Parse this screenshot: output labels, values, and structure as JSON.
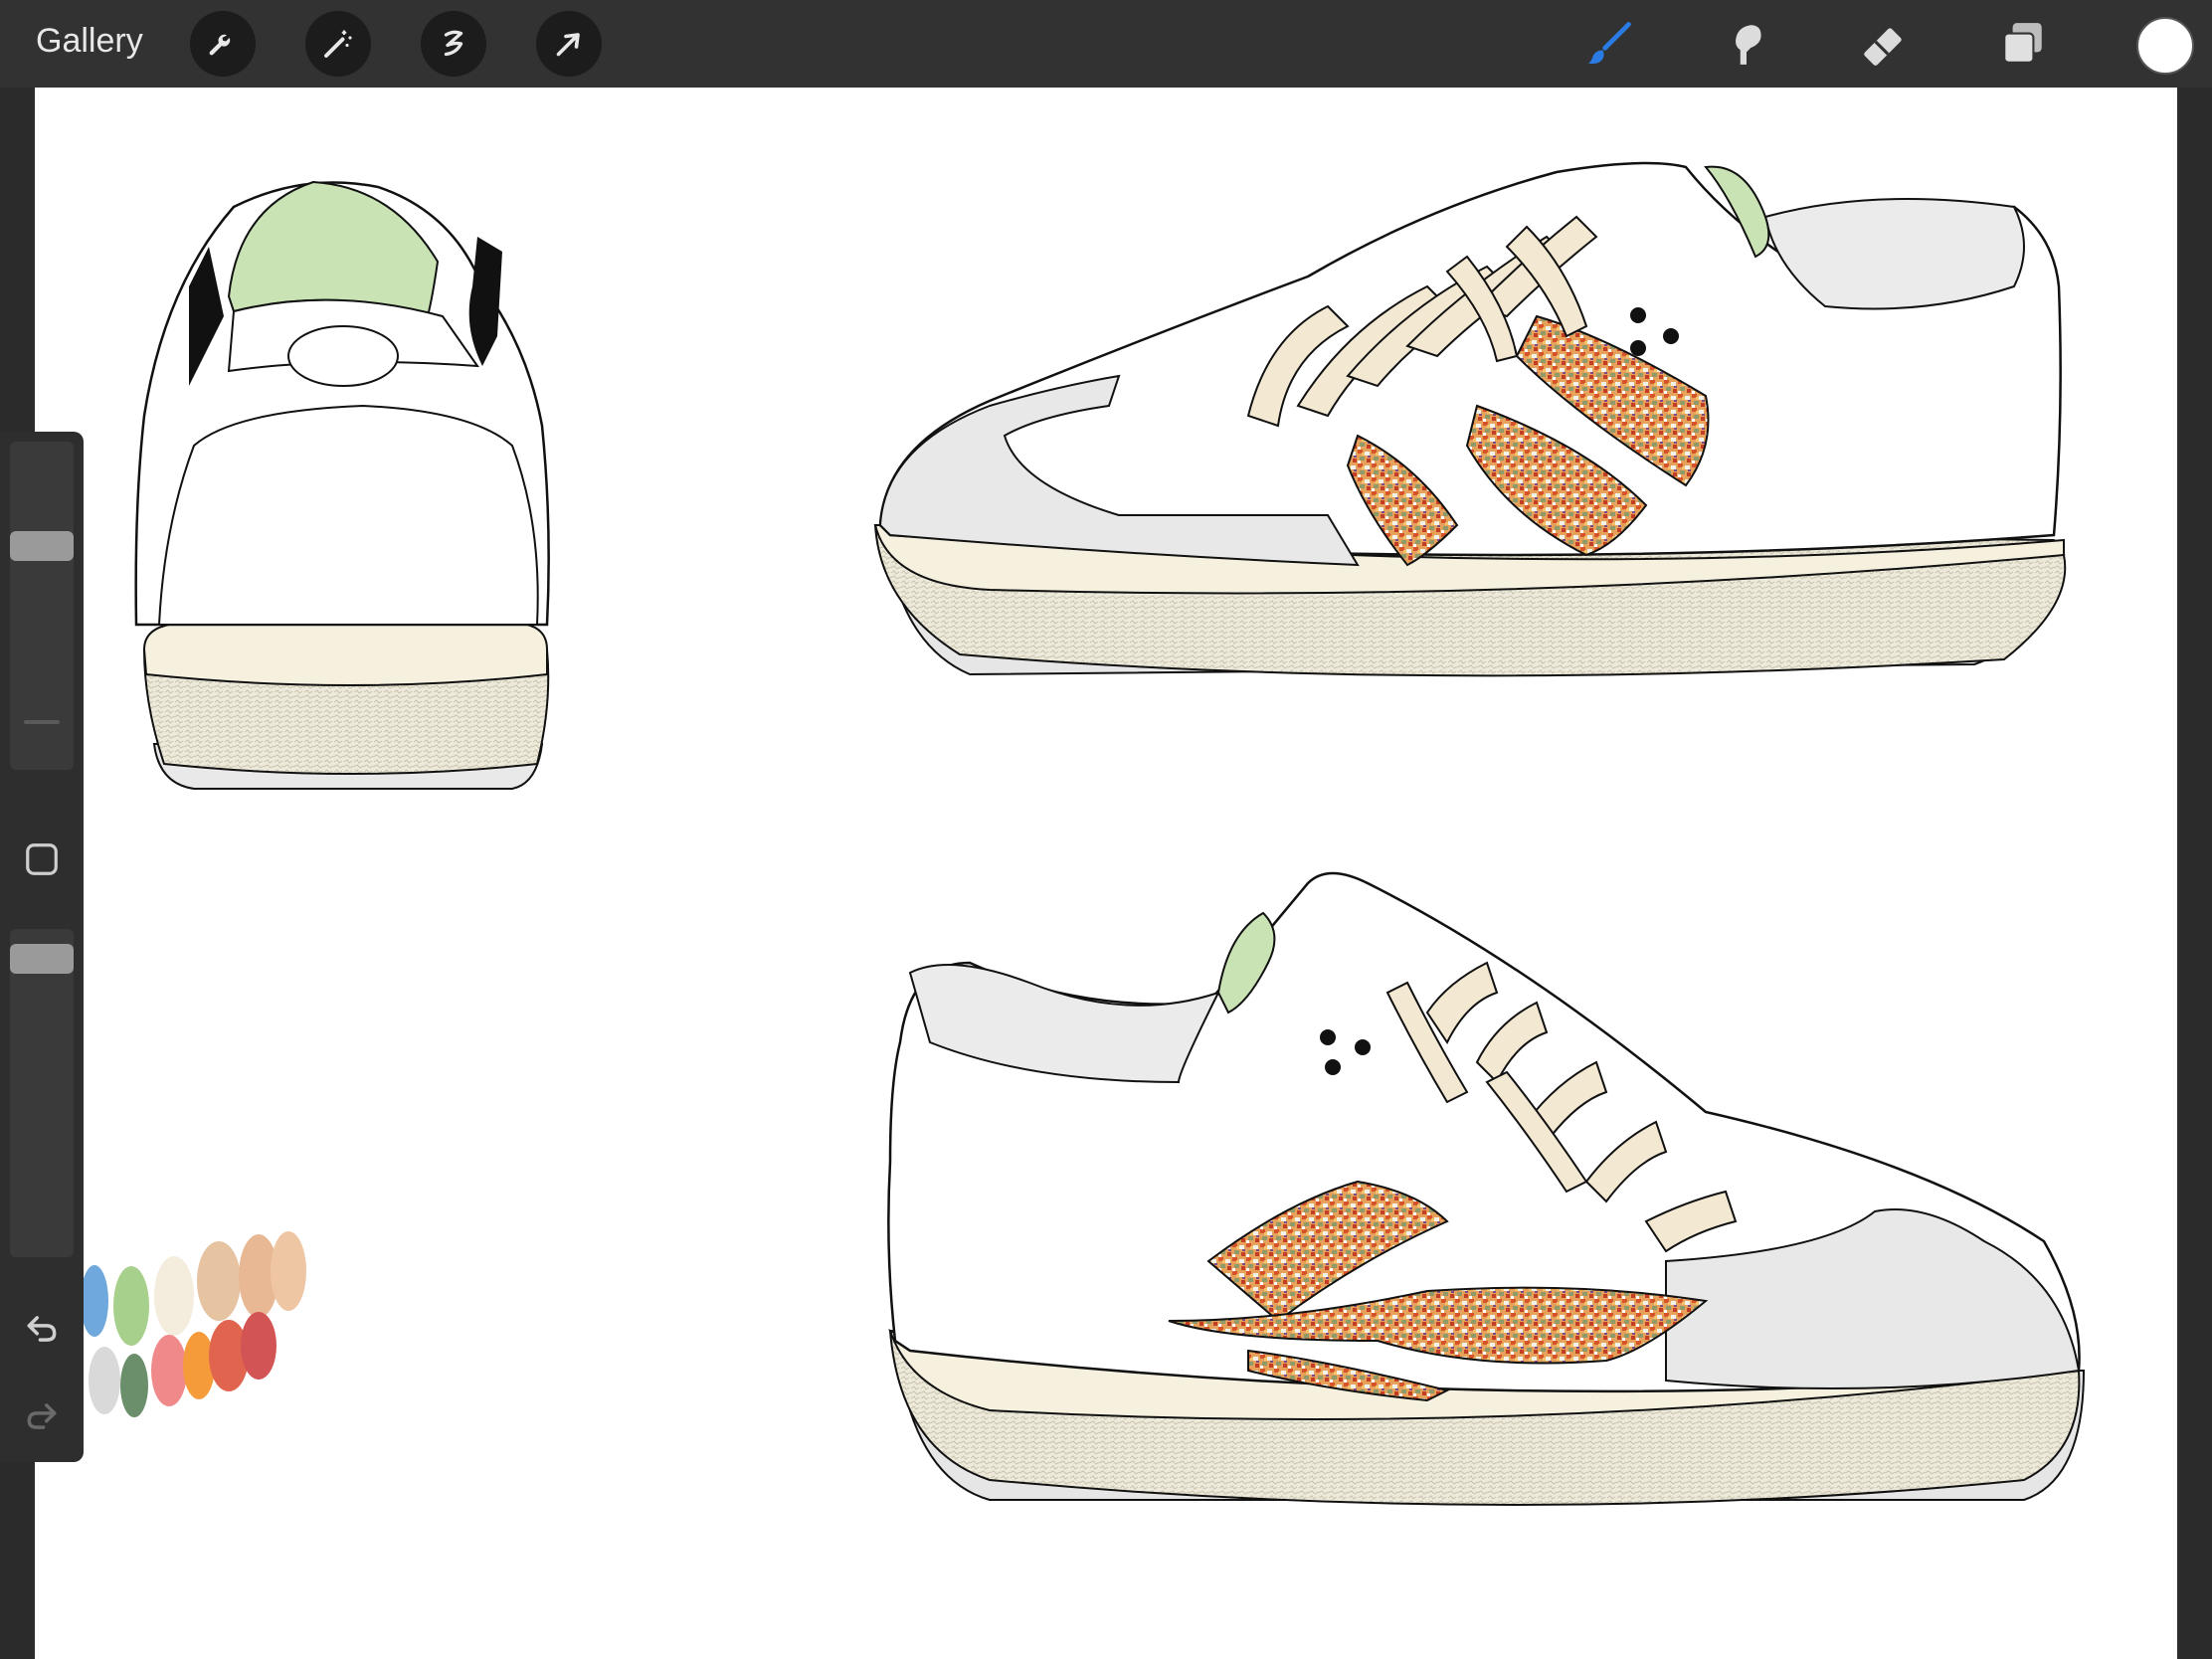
{
  "app": {
    "gallery_label": "Gallery"
  },
  "toolbar_left": [
    {
      "name": "actions-wrench-icon"
    },
    {
      "name": "adjustments-wand-icon"
    },
    {
      "name": "selection-s-icon"
    },
    {
      "name": "transform-arrow-icon"
    }
  ],
  "toolbar_right": [
    {
      "name": "brush-icon",
      "active": true
    },
    {
      "name": "smudge-icon"
    },
    {
      "name": "eraser-icon"
    },
    {
      "name": "layers-icon"
    }
  ],
  "colors": {
    "active_brush": "#2a7be4",
    "current_color": "#ffffff",
    "toolbar_bg": "#323232",
    "canvas_bg": "#ffffff",
    "collar_green": "#c9e3b5",
    "lace_cream": "#f3e8d2",
    "midsole_cream": "#f6f1df",
    "toe_grey": "#e8e8e8"
  },
  "sidebar": {
    "brush_size_level": 0.7,
    "opacity_level": 0.95
  },
  "palette_swatches": [
    "#6fa8dc",
    "#a8d08d",
    "#f4ecdc",
    "#e6c3a1",
    "#e8b894",
    "#d9d9d9",
    "#6b8f6b",
    "#f08a8a",
    "#f59b3a",
    "#e0644e",
    "#d35454"
  ]
}
